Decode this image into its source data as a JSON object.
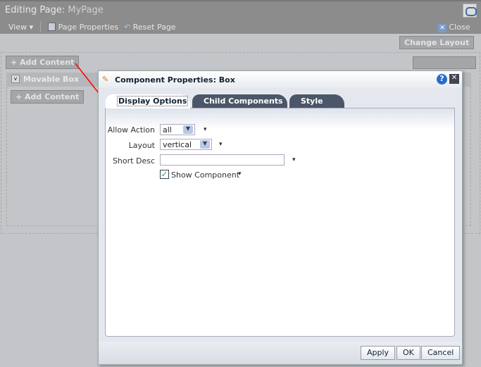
{
  "header": {
    "title_prefix": "Editing Page:",
    "page_name": "MyPage",
    "view": "View",
    "page_properties": "Page Properties",
    "reset_page": "Reset Page",
    "close": "Close"
  },
  "page": {
    "change_layout": "Change Layout",
    "add_content": "+ Add Content",
    "movable_box": "Movable Box",
    "inner_add_content": "+ Add Content"
  },
  "dialog": {
    "title": "Component Properties: Box",
    "tabs": [
      "Display Options",
      "Child Components",
      "Style"
    ],
    "fields": {
      "allow_action_label": "Allow Action",
      "allow_action_value": "all",
      "layout_label": "Layout",
      "layout_value": "vertical",
      "short_desc_label": "Short Desc",
      "short_desc_value": "",
      "show_component_label": "Show Component",
      "show_component_checked": true
    },
    "buttons": {
      "apply": "Apply",
      "ok": "OK",
      "cancel": "Cancel"
    }
  },
  "colors": {
    "arrow": "#ff0000",
    "tab_dark": "#4b5768",
    "check": "#2a9a2a"
  }
}
